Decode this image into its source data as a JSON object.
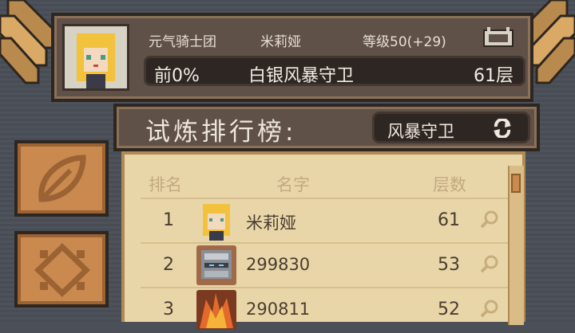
{
  "profile": {
    "guild": "元气骑士团",
    "name": "米莉娅",
    "level": "等级50(+29)",
    "rank_percent": "前0%",
    "title": "白银风暴守卫",
    "floor": "61层"
  },
  "leaderboard": {
    "title": "试炼排行榜:",
    "mode": "风暴守卫",
    "headers": {
      "rank": "排名",
      "name": "名字",
      "floor": "层数"
    },
    "rows": [
      {
        "rank": "1",
        "name": "米莉娅",
        "floor": "61",
        "avatar": "blonde-girl"
      },
      {
        "rank": "2",
        "name": "299830",
        "floor": "53",
        "avatar": "knight-helmet"
      },
      {
        "rank": "3",
        "name": "290811",
        "floor": "52",
        "avatar": "fire-beast"
      }
    ]
  },
  "side_buttons": [
    {
      "icon": "leaf-icon"
    },
    {
      "icon": "diamond-icon"
    }
  ],
  "colors": {
    "panel_bg": "#5f5148",
    "list_bg": "#e9d6a8",
    "button_orange": "#c9894f",
    "text_light": "#efe7dc"
  }
}
